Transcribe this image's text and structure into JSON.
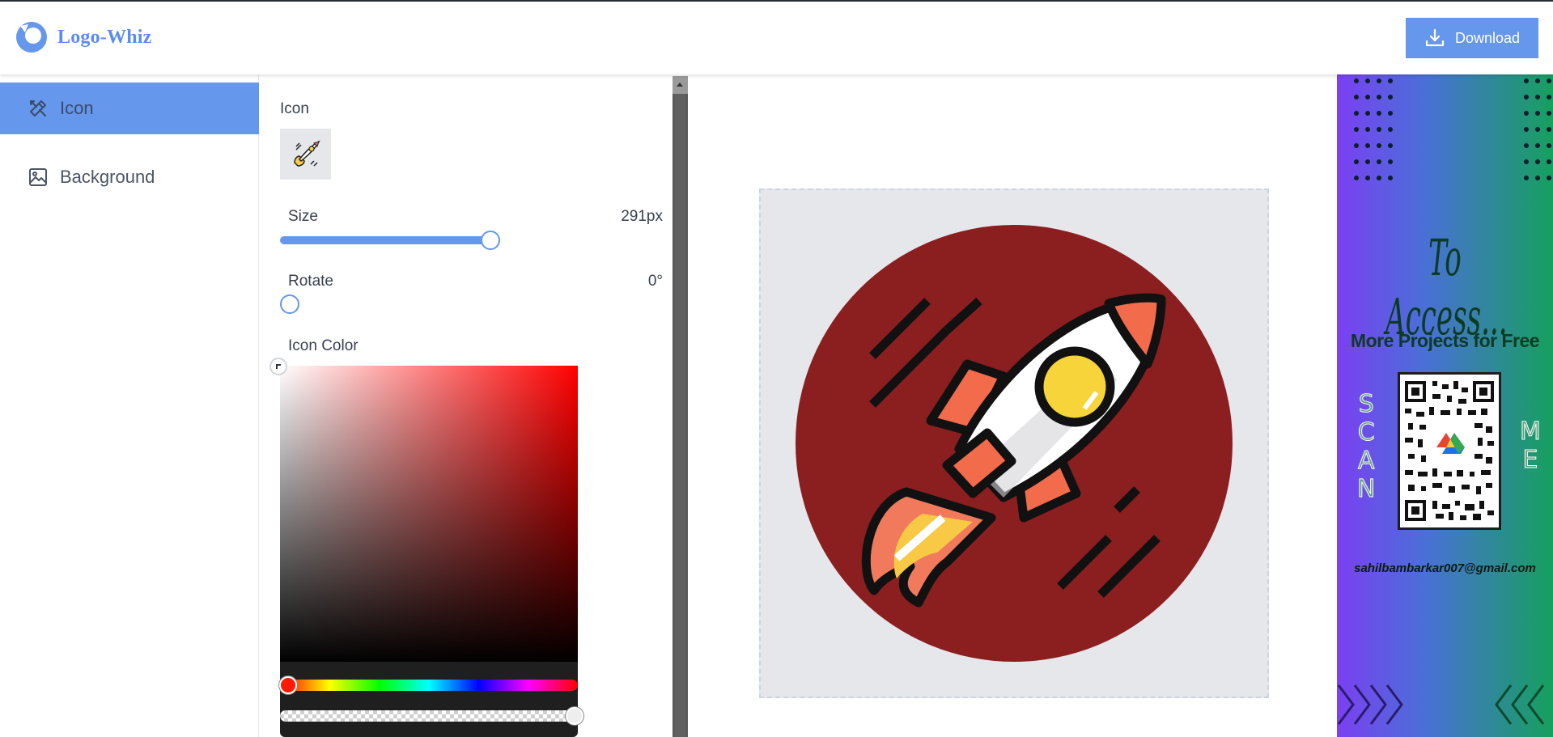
{
  "app": {
    "name": "Logo-Whiz",
    "brand_color": "#6597ec"
  },
  "header": {
    "download_label": "Download"
  },
  "sidebar": {
    "items": [
      {
        "label": "Icon",
        "icon": "icon-tools-icon",
        "active": true
      },
      {
        "label": "Background",
        "icon": "image-icon",
        "active": false
      }
    ]
  },
  "panel": {
    "icon_label": "Icon",
    "selected_icon": "rocket-icon",
    "size": {
      "label": "Size",
      "value": "291px",
      "fraction": 0.96
    },
    "rotate": {
      "label": "Rotate",
      "value": "0°",
      "fraction": 0.0
    },
    "icon_color": {
      "label": "Icon Color",
      "color": "#ff0000",
      "hue_color": "#ff0000"
    }
  },
  "canvas": {
    "background_color": "#8b1e1f",
    "icon": "rocket-icon"
  },
  "promo": {
    "title": "To Access...",
    "subtitle": "More Projects for Free",
    "left_letters": [
      "S",
      "C",
      "A",
      "N"
    ],
    "right_letters": [
      "M",
      "E"
    ],
    "email": "sahilbambarkar007@gmail.com"
  }
}
